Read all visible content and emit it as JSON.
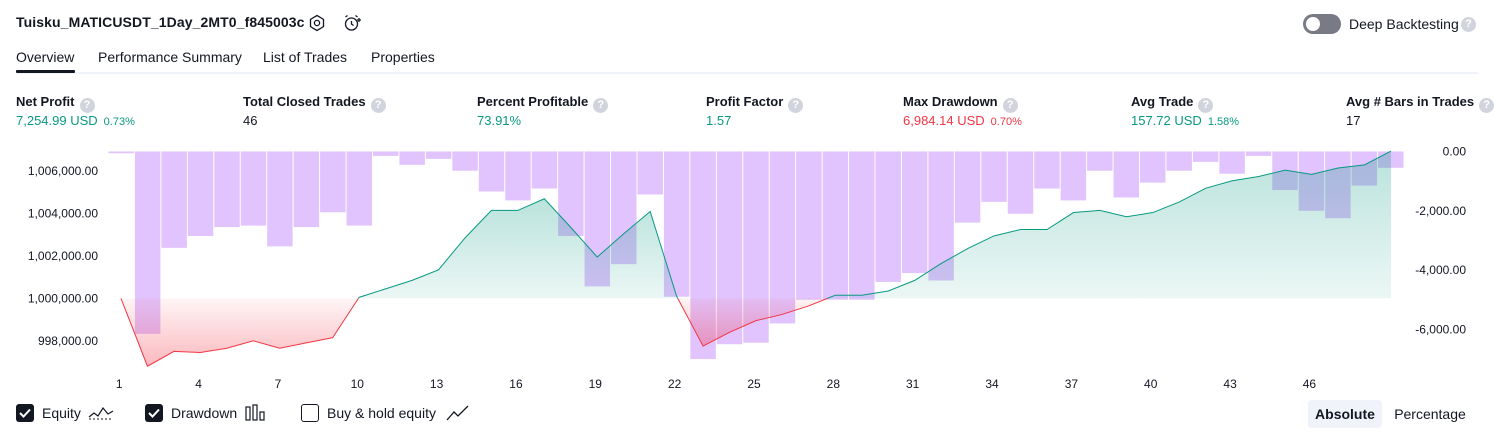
{
  "header": {
    "strategy_name": "Tuisku_MATICUSDT_1Day_2MT0_f845003c",
    "settings_icon": "settings-gear-icon",
    "alert_icon": "add-alert-clock-icon",
    "deep_backtesting_label": "Deep Backtesting",
    "deep_backtesting_enabled": false,
    "help_glyph": "?"
  },
  "tabs": [
    {
      "label": "Overview",
      "active": true
    },
    {
      "label": "Performance Summary",
      "active": false
    },
    {
      "label": "List of Trades",
      "active": false
    },
    {
      "label": "Properties",
      "active": false
    }
  ],
  "metrics": [
    {
      "label": "Net Profit",
      "value": "7,254.99 USD",
      "pct": "0.73%",
      "tone": "pos"
    },
    {
      "label": "Total Closed Trades",
      "value": "46",
      "pct": "",
      "tone": "dark"
    },
    {
      "label": "Percent Profitable",
      "value": "73.91%",
      "pct": "",
      "tone": "pos"
    },
    {
      "label": "Profit Factor",
      "value": "1.57",
      "pct": "",
      "tone": "pos"
    },
    {
      "label": "Max Drawdown",
      "value": "6,984.14 USD",
      "pct": "0.70%",
      "tone": "neg"
    },
    {
      "label": "Avg Trade",
      "value": "157.72 USD",
      "pct": "1.58%",
      "tone": "pos"
    },
    {
      "label": "Avg # Bars in Trades",
      "value": "17",
      "pct": "",
      "tone": "dark"
    }
  ],
  "chart_data": {
    "type": "area",
    "x": [
      1,
      2,
      3,
      4,
      5,
      6,
      7,
      8,
      9,
      10,
      11,
      12,
      13,
      14,
      15,
      16,
      17,
      18,
      19,
      20,
      21,
      22,
      23,
      24,
      25,
      26,
      27,
      28,
      29,
      30,
      31,
      32,
      33,
      34,
      35,
      36,
      37,
      38,
      39,
      40,
      41,
      42,
      43,
      44,
      45,
      46,
      47
    ],
    "x_tick_labels": [
      "1",
      "4",
      "7",
      "10",
      "13",
      "16",
      "19",
      "22",
      "25",
      "28",
      "31",
      "34",
      "37",
      "40",
      "43",
      "46"
    ],
    "equity_baseline": 1000000,
    "series": [
      {
        "name": "Equity",
        "axis": "left",
        "values": [
          1000000,
          996800,
          997500,
          997450,
          997650,
          998000,
          997650,
          997900,
          998150,
          1000050,
          1000450,
          1000850,
          1001350,
          1002850,
          1004150,
          1004150,
          1004700,
          1003350,
          1001950,
          1003050,
          1004100,
          1000100,
          997750,
          998400,
          998950,
          999250,
          999650,
          1000150,
          1000150,
          1000350,
          1000850,
          1001650,
          1002350,
          1002950,
          1003250,
          1003250,
          1004050,
          1004150,
          1003850,
          1004050,
          1004550,
          1005200,
          1005550,
          1005750,
          1006050,
          1005850,
          1006150,
          1006300,
          1006950
        ],
        "color": "#089981",
        "negative_color": "#f23645"
      },
      {
        "name": "Drawdown",
        "axis": "right",
        "values": [
          -60,
          -6150,
          -3250,
          -2850,
          -2550,
          -2500,
          -3200,
          -2550,
          -2050,
          -2500,
          -150,
          -450,
          -250,
          -650,
          -1350,
          -1650,
          -1250,
          -2850,
          -4550,
          -3800,
          -1450,
          -4900,
          -7000,
          -6500,
          -6450,
          -5800,
          -5000,
          -5000,
          -5000,
          -4400,
          -4100,
          -4350,
          -2400,
          -1700,
          -2100,
          -1250,
          -1650,
          -650,
          -1550,
          -1050,
          -650,
          -350,
          -750,
          -150,
          -1300,
          -2000,
          -2250,
          -1150,
          -550
        ],
        "color": "#e1c4fd"
      }
    ],
    "ylim_left": [
      997000,
      1007000
    ],
    "ylim_right": [
      -7100,
      50
    ],
    "left_ticks": [
      "1,006,000.00",
      "1,004,000.00",
      "1,002,000.00",
      "1,000,000.00",
      "998,000.00"
    ],
    "left_tick_values": [
      1006000,
      1004000,
      1002000,
      1000000,
      998000
    ],
    "right_ticks": [
      "0.00",
      "-2,000.00",
      "-4,000.00",
      "-6,000.00"
    ],
    "right_tick_values": [
      0,
      -2000,
      -4000,
      -6000
    ],
    "grid": false
  },
  "legend": [
    {
      "label": "Equity",
      "checked": true,
      "icon": "equity-line-icon"
    },
    {
      "label": "Drawdown",
      "checked": true,
      "icon": "drawdown-bars-icon"
    },
    {
      "label": "Buy & hold equity",
      "checked": false,
      "icon": "buyhold-line-icon"
    }
  ],
  "view_toggle": {
    "absolute_label": "Absolute",
    "percentage_label": "Percentage",
    "selected": "Absolute"
  }
}
